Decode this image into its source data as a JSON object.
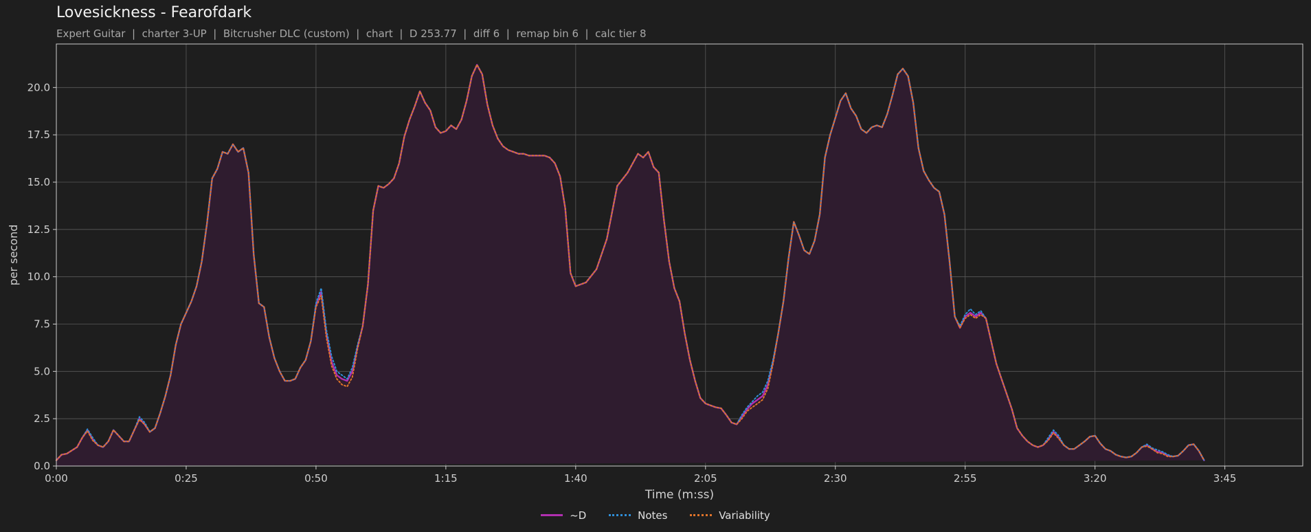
{
  "title": "Lovesickness - Fearofdark",
  "subtitle": "Expert Guitar  |  charter 3-UP  |  Bitcrusher DLC (custom)  |  chart  |  D 253.77  |  diff 6  |  remap bin 6  |  calc tier 8",
  "colors": {
    "background": "#1e1e1e",
    "grid": "#5a5a5a",
    "axis": "#cfcfcf",
    "fill": "#2f1c2f",
    "d": "#b12fb0",
    "notes": "#2f8ed8",
    "variability": "#e0742a"
  },
  "chart_data": {
    "type": "line",
    "xlabel": "Time (m:ss)",
    "ylabel": "per second",
    "xlim": [
      0,
      240
    ],
    "ylim": [
      0,
      22.3
    ],
    "x_ticks": [
      0,
      25,
      50,
      75,
      100,
      125,
      150,
      175,
      200,
      225
    ],
    "x_tick_labels": [
      "0:00",
      "0:25",
      "0:50",
      "1:15",
      "1:40",
      "2:05",
      "2:30",
      "2:55",
      "3:20",
      "3:45"
    ],
    "y_ticks": [
      0,
      2.5,
      5,
      7.5,
      10,
      12.5,
      15,
      17.5,
      20
    ],
    "y_tick_labels": [
      "0.0",
      "2.5",
      "5.0",
      "7.5",
      "10.0",
      "12.5",
      "15.0",
      "17.5",
      "20.0"
    ],
    "grid": true,
    "legend_position": "bottom-center",
    "x": [
      0,
      1,
      2,
      4,
      5,
      6,
      7,
      8,
      9,
      10,
      11,
      12,
      13,
      14,
      15,
      16,
      17,
      18,
      19,
      20,
      21,
      22,
      23,
      24,
      25,
      26,
      27,
      28,
      29,
      30,
      31,
      32,
      33,
      34,
      35,
      36,
      37,
      38,
      39,
      40,
      41,
      42,
      43,
      44,
      45,
      46,
      47,
      48,
      49,
      50,
      51,
      52,
      53,
      54,
      55,
      56,
      57,
      58,
      59,
      60,
      61,
      62,
      63,
      64,
      65,
      66,
      67,
      68,
      69,
      70,
      71,
      72,
      73,
      74,
      75,
      76,
      77,
      78,
      79,
      80,
      81,
      82,
      83,
      84,
      85,
      86,
      87,
      88,
      89,
      90,
      91,
      92,
      93,
      94,
      95,
      96,
      97,
      98,
      99,
      100,
      102,
      104,
      106,
      108,
      110,
      112,
      113,
      114,
      115,
      116,
      117,
      118,
      119,
      120,
      121,
      122,
      123,
      124,
      125,
      126,
      127,
      128,
      129,
      130,
      131,
      132,
      133,
      134,
      135,
      136,
      137,
      138,
      139,
      140,
      141,
      142,
      143,
      144,
      145,
      146,
      147,
      148,
      149,
      150,
      151,
      152,
      153,
      154,
      155,
      156,
      157,
      158,
      159,
      160,
      161,
      162,
      163,
      164,
      165,
      166,
      167,
      168,
      169,
      170,
      171,
      172,
      173,
      174,
      175,
      176,
      177,
      178,
      179,
      180,
      181,
      182,
      183,
      184,
      185,
      186,
      187,
      188,
      189,
      190,
      191,
      192,
      193,
      194,
      195,
      196,
      197,
      198,
      199,
      200,
      201,
      202,
      203,
      204,
      205,
      206,
      207,
      208,
      209,
      210,
      211,
      212,
      213,
      214,
      215,
      216,
      217,
      218,
      219,
      220,
      221,
      222,
      223,
      224,
      225,
      226,
      227,
      228,
      229,
      230,
      231,
      232,
      233,
      234,
      235,
      236,
      237,
      238,
      239,
      240
    ],
    "series": [
      {
        "name": "~D",
        "style": "solid",
        "values": [
          0.3,
          0.6,
          0.65,
          1.0,
          1.5,
          1.9,
          1.4,
          1.1,
          1.0,
          1.3,
          1.9,
          1.6,
          1.3,
          1.3,
          1.9,
          2.5,
          2.2,
          1.8,
          2.0,
          2.8,
          3.7,
          4.8,
          6.4,
          7.5,
          8.1,
          8.7,
          9.5,
          10.8,
          12.8,
          15.2,
          15.7,
          16.6,
          16.5,
          17.0,
          16.6,
          16.8,
          15.5,
          11.2,
          8.6,
          8.4,
          6.8,
          5.7,
          5.0,
          4.5,
          4.5,
          4.6,
          5.2,
          5.6,
          6.6,
          8.5,
          9.2,
          7.0,
          5.5,
          4.8,
          4.6,
          4.5,
          5.0,
          6.3,
          7.4,
          9.6,
          13.5,
          14.8,
          14.7,
          14.9,
          15.2,
          16.0,
          17.4,
          18.3,
          19.0,
          19.8,
          19.2,
          18.8,
          17.9,
          17.6,
          17.7,
          18.0,
          17.8,
          18.3,
          19.3,
          20.6,
          21.2,
          20.7,
          19.1,
          18.0,
          17.3,
          16.9,
          16.7,
          16.6,
          16.5,
          16.5,
          16.4,
          16.4,
          16.4,
          16.4,
          16.3,
          16.0,
          15.3,
          13.6,
          10.2,
          9.5,
          9.7,
          10.4,
          12.0,
          14.8,
          15.5,
          16.5,
          16.3,
          16.6,
          15.8,
          15.5,
          13.0,
          10.8,
          9.4,
          8.7,
          7.0,
          5.6,
          4.5,
          3.6,
          3.3,
          3.2,
          3.1,
          3.05,
          2.7,
          2.3,
          2.2,
          2.6,
          3.0,
          3.3,
          3.5,
          3.7,
          4.3,
          5.5,
          7.0,
          8.7,
          11.0,
          12.9,
          12.2,
          11.4,
          11.2,
          11.9,
          13.3,
          16.3,
          17.5,
          18.4,
          19.3,
          19.7,
          18.9,
          18.5,
          17.8,
          17.6,
          17.9,
          18.0,
          17.9,
          18.6,
          19.6,
          20.7,
          21.0,
          20.6,
          19.2,
          16.8,
          15.6,
          15.1,
          14.7,
          14.5,
          13.3,
          10.8,
          7.9,
          7.3,
          7.9,
          8.1,
          7.9,
          8.1,
          7.8,
          6.6,
          5.4,
          4.6,
          3.8,
          3.0,
          2.0,
          1.6,
          1.3,
          1.1,
          1.0,
          1.1,
          1.4,
          1.8,
          1.5,
          1.1,
          0.9,
          0.9,
          1.1,
          1.3,
          1.55,
          1.6,
          1.2,
          0.9,
          0.8,
          0.6,
          0.5,
          0.45,
          0.5,
          0.7,
          1.0,
          1.1,
          0.9,
          0.75,
          0.7,
          0.55,
          0.5,
          0.55,
          0.8,
          1.1,
          1.15,
          0.8,
          0.3
        ]
      },
      {
        "name": "Notes",
        "style": "dotted",
        "values": [
          0.3,
          0.6,
          0.65,
          1.0,
          1.5,
          1.95,
          1.5,
          1.1,
          1.0,
          1.3,
          1.9,
          1.6,
          1.3,
          1.3,
          1.9,
          2.6,
          2.3,
          1.8,
          2.0,
          2.8,
          3.7,
          4.8,
          6.4,
          7.5,
          8.1,
          8.7,
          9.5,
          10.8,
          12.8,
          15.2,
          15.7,
          16.6,
          16.5,
          17.0,
          16.6,
          16.8,
          15.5,
          11.2,
          8.6,
          8.4,
          6.8,
          5.7,
          5.0,
          4.5,
          4.5,
          4.6,
          5.2,
          5.6,
          6.6,
          8.6,
          9.4,
          7.2,
          5.8,
          5.0,
          4.8,
          4.6,
          5.2,
          6.4,
          7.4,
          9.6,
          13.5,
          14.8,
          14.7,
          14.9,
          15.2,
          16.0,
          17.4,
          18.3,
          19.0,
          19.8,
          19.2,
          18.8,
          17.9,
          17.6,
          17.7,
          18.0,
          17.8,
          18.3,
          19.3,
          20.6,
          21.2,
          20.7,
          19.1,
          18.0,
          17.3,
          16.9,
          16.7,
          16.6,
          16.5,
          16.5,
          16.4,
          16.4,
          16.4,
          16.4,
          16.3,
          16.0,
          15.3,
          13.6,
          10.2,
          9.5,
          9.7,
          10.4,
          12.0,
          14.8,
          15.5,
          16.5,
          16.3,
          16.6,
          15.8,
          15.5,
          13.0,
          10.8,
          9.4,
          8.7,
          7.0,
          5.6,
          4.5,
          3.6,
          3.3,
          3.2,
          3.1,
          3.05,
          2.7,
          2.3,
          2.2,
          2.7,
          3.1,
          3.4,
          3.7,
          3.9,
          4.5,
          5.6,
          7.0,
          8.7,
          11.0,
          12.9,
          12.2,
          11.4,
          11.2,
          11.9,
          13.3,
          16.3,
          17.5,
          18.4,
          19.3,
          19.7,
          18.9,
          18.5,
          17.8,
          17.6,
          17.9,
          18.0,
          17.9,
          18.6,
          19.6,
          20.7,
          21.0,
          20.6,
          19.2,
          16.8,
          15.6,
          15.1,
          14.7,
          14.5,
          13.3,
          10.8,
          7.9,
          7.4,
          8.0,
          8.3,
          8.0,
          8.2,
          7.8,
          6.6,
          5.4,
          4.6,
          3.8,
          3.0,
          2.0,
          1.6,
          1.3,
          1.1,
          1.0,
          1.1,
          1.5,
          1.9,
          1.6,
          1.1,
          0.9,
          0.9,
          1.1,
          1.3,
          1.55,
          1.6,
          1.2,
          0.9,
          0.8,
          0.6,
          0.5,
          0.45,
          0.5,
          0.7,
          1.0,
          1.15,
          0.95,
          0.85,
          0.75,
          0.6,
          0.5,
          0.55,
          0.8,
          1.1,
          1.15,
          0.8,
          0.3
        ]
      },
      {
        "name": "Variability",
        "style": "dotted",
        "values": [
          0.3,
          0.6,
          0.65,
          1.0,
          1.5,
          1.85,
          1.35,
          1.1,
          1.0,
          1.3,
          1.9,
          1.6,
          1.3,
          1.3,
          1.9,
          2.45,
          2.2,
          1.8,
          2.0,
          2.8,
          3.7,
          4.8,
          6.4,
          7.5,
          8.1,
          8.7,
          9.5,
          10.8,
          12.8,
          15.2,
          15.7,
          16.6,
          16.5,
          17.0,
          16.6,
          16.8,
          15.5,
          11.2,
          8.6,
          8.4,
          6.8,
          5.7,
          5.0,
          4.5,
          4.5,
          4.6,
          5.2,
          5.6,
          6.6,
          8.4,
          9.0,
          6.8,
          5.3,
          4.6,
          4.3,
          4.2,
          4.7,
          6.2,
          7.4,
          9.6,
          13.5,
          14.8,
          14.7,
          14.9,
          15.2,
          16.0,
          17.4,
          18.3,
          19.0,
          19.8,
          19.2,
          18.8,
          17.9,
          17.6,
          17.7,
          18.0,
          17.8,
          18.3,
          19.3,
          20.6,
          21.2,
          20.7,
          19.1,
          18.0,
          17.3,
          16.9,
          16.7,
          16.6,
          16.5,
          16.5,
          16.4,
          16.4,
          16.4,
          16.4,
          16.3,
          16.0,
          15.3,
          13.6,
          10.2,
          9.5,
          9.7,
          10.4,
          12.0,
          14.8,
          15.5,
          16.5,
          16.3,
          16.6,
          15.8,
          15.5,
          13.0,
          10.8,
          9.4,
          8.7,
          7.0,
          5.6,
          4.5,
          3.6,
          3.3,
          3.2,
          3.1,
          3.05,
          2.7,
          2.3,
          2.2,
          2.5,
          2.9,
          3.1,
          3.3,
          3.5,
          4.1,
          5.4,
          7.0,
          8.7,
          11.0,
          12.9,
          12.2,
          11.4,
          11.2,
          11.9,
          13.3,
          16.3,
          17.5,
          18.4,
          19.3,
          19.7,
          18.9,
          18.5,
          17.8,
          17.6,
          17.9,
          18.0,
          17.9,
          18.6,
          19.6,
          20.7,
          21.0,
          20.6,
          19.2,
          16.8,
          15.6,
          15.1,
          14.7,
          14.5,
          13.3,
          10.8,
          7.9,
          7.3,
          7.8,
          8.0,
          7.8,
          8.0,
          7.8,
          6.6,
          5.4,
          4.6,
          3.8,
          3.0,
          2.0,
          1.6,
          1.3,
          1.1,
          1.0,
          1.1,
          1.35,
          1.75,
          1.45,
          1.1,
          0.9,
          0.9,
          1.1,
          1.3,
          1.55,
          1.6,
          1.2,
          0.9,
          0.8,
          0.6,
          0.5,
          0.45,
          0.5,
          0.7,
          1.0,
          1.05,
          0.9,
          0.7,
          0.65,
          0.5,
          0.5,
          0.55,
          0.8,
          1.1,
          1.15,
          0.8,
          0.3
        ]
      }
    ]
  }
}
